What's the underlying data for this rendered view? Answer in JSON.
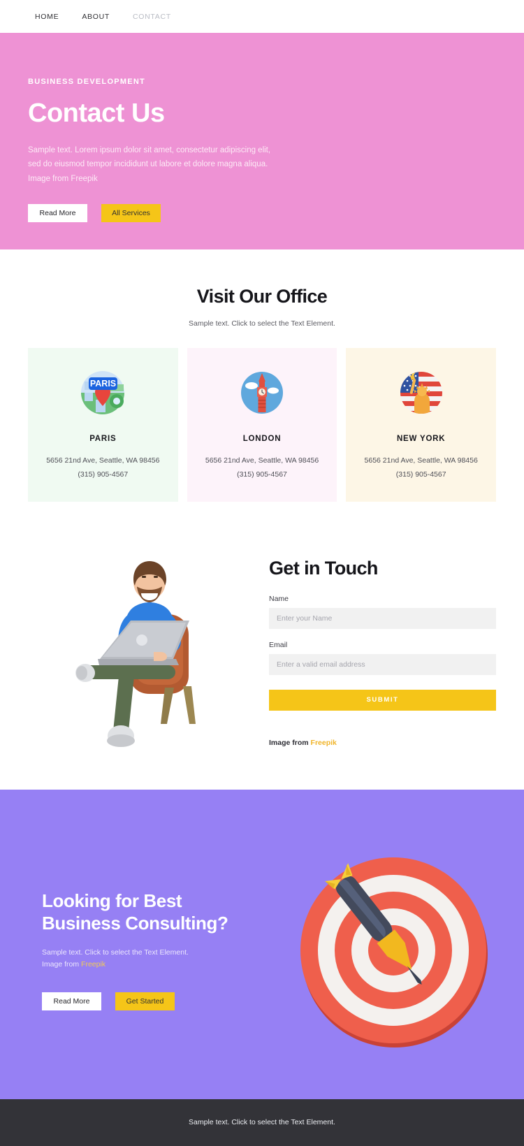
{
  "nav": {
    "items": [
      {
        "label": "HOME",
        "active": false
      },
      {
        "label": "ABOUT",
        "active": false
      },
      {
        "label": "CONTACT",
        "active": true
      }
    ]
  },
  "hero": {
    "eyebrow": "BUSINESS DEVELOPMENT",
    "title": "Contact Us",
    "subtitle": "Sample text. Lorem ipsum dolor sit amet, consectetur adipiscing elit, sed do eiusmod tempor incididunt ut labore et dolore magna aliqua. Image from Freepik",
    "primary_button": "Read More",
    "secondary_button": "All Services",
    "background_color": "#ee92d4"
  },
  "office": {
    "title": "Visit Our Office",
    "subtitle": "Sample text. Click to select the Text Element.",
    "cards": [
      {
        "name": "PARIS",
        "address": "5656 21nd Ave, Seattle, WA 98456",
        "phone": "(315) 905-4567",
        "icon": "paris-map-pin-icon",
        "background_color": "#f0faf2"
      },
      {
        "name": "LONDON",
        "address": "5656 21nd Ave, Seattle, WA 98456",
        "phone": "(315) 905-4567",
        "icon": "london-big-ben-icon",
        "background_color": "#fdf3fa"
      },
      {
        "name": "NEW YORK",
        "address": "5656 21nd Ave, Seattle, WA 98456",
        "phone": "(315) 905-4567",
        "icon": "new-york-statue-of-liberty-icon",
        "background_color": "#fdf6e6"
      }
    ]
  },
  "contact": {
    "title": "Get in Touch",
    "illustration": "man-on-armchair-with-laptop-illustration",
    "name_label": "Name",
    "name_placeholder": "Enter your Name",
    "name_value": "",
    "email_label": "Email",
    "email_placeholder": "Enter a valid email address",
    "email_value": "",
    "submit_label": "SUBMIT",
    "credit_prefix": "Image from",
    "credit_link": "Freepik",
    "credit_link_color": "#f0b429"
  },
  "cta": {
    "title_line1": "Looking for Best",
    "title_line2": "Business Consulting?",
    "subtitle_line1": "Sample text. Click to select the Text Element.",
    "subtitle_line2_prefix": "Image from",
    "subtitle_link": "Freepik",
    "primary_button": "Read More",
    "secondary_button": "Get Started",
    "illustration": "dartboard-with-dart-illustration",
    "background_color": "#9680f4"
  },
  "footer": {
    "text": "Sample text. Click to select the Text Element.",
    "background_color": "#333338"
  }
}
